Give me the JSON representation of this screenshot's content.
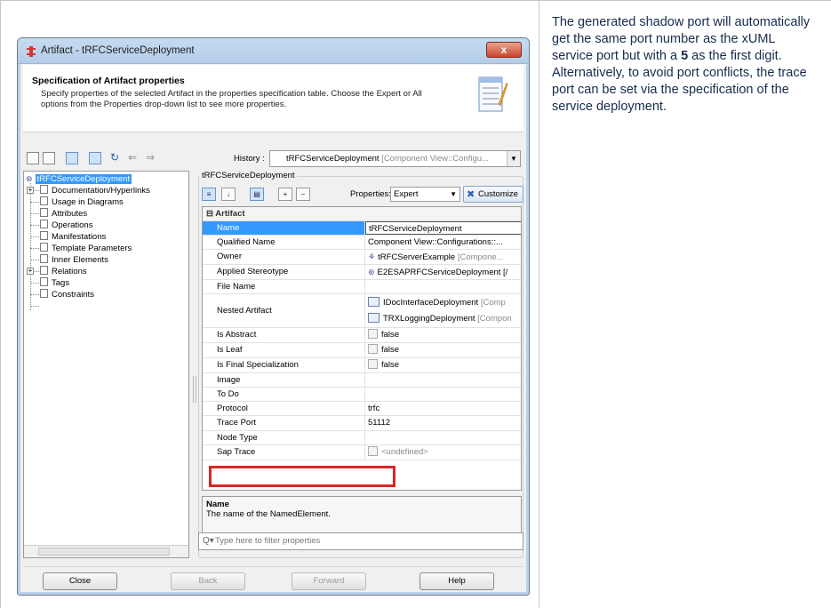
{
  "note": {
    "line1": "The generated shadow port will automatically get the same port number as the xUML service port but with a ",
    "digit": "5",
    "line2": " as the first digit. Alternatively, to avoid port conflicts, the trace port can be set via the specification of the service deployment."
  },
  "dialog": {
    "title": "Artifact - tRFCServiceDeployment",
    "close_glyph": "x",
    "header_title": "Specification of Artifact properties",
    "header_desc": "Specify properties of the selected Artifact in the properties specification table. Choose the Expert or All options from the Properties drop-down list to see more properties.",
    "history_label": "History :",
    "history_value": "tRFCServiceDeployment",
    "history_muted": " [Component View::Configu...",
    "tree": [
      {
        "label": "tRFCServiceDeployment",
        "selected": true
      },
      {
        "label": "Documentation/Hyperlinks"
      },
      {
        "label": "Usage in Diagrams"
      },
      {
        "label": "Attributes"
      },
      {
        "label": "Operations"
      },
      {
        "label": "Manifestations"
      },
      {
        "label": "Template Parameters"
      },
      {
        "label": "Inner Elements"
      },
      {
        "label": "Relations"
      },
      {
        "label": "Tags"
      },
      {
        "label": "Constraints"
      }
    ],
    "group_title": "tRFCServiceDeployment",
    "properties_label": "Properties:",
    "properties_value": "Expert",
    "customize_label": "Customize",
    "category": "Artifact",
    "rows": {
      "name_k": "Name",
      "name_v": "tRFCServiceDeployment",
      "qname_k": "Qualified Name",
      "qname_v": "Component View::Configurations::...",
      "owner_k": "Owner",
      "owner_v": "tRFCServerExample",
      "owner_muted": " [Compone...",
      "stereo_k": "Applied Stereotype",
      "stereo_v": "E2ESAPRFCServiceDeployment [/",
      "file_k": "File Name",
      "nested_k": "Nested Artifact",
      "nested_v1": "IDocInterfaceDeployment",
      "nested_v1_muted": " [Comp",
      "nested_v2": "TRXLoggingDeployment",
      "nested_v2_muted": " [Compon",
      "abstract_k": "Is Abstract",
      "abstract_v": "false",
      "leaf_k": "Is Leaf",
      "leaf_v": "false",
      "final_k": "Is Final Specialization",
      "final_v": "false",
      "image_k": "Image",
      "todo_k": "To Do",
      "protocol_k": "Protocol",
      "protocol_v": "trfc",
      "trace_k": "Trace Port",
      "trace_v": "51112",
      "node_k": "Node Type",
      "sap_k": "Sap Trace",
      "sap_v": "<undefined>"
    },
    "desc_title": "Name",
    "desc_text": "The name of the NamedElement.",
    "filter_placeholder": "Type here to filter properties",
    "buttons": {
      "close": "Close",
      "back": "Back",
      "forward": "Forward",
      "help": "Help"
    }
  }
}
